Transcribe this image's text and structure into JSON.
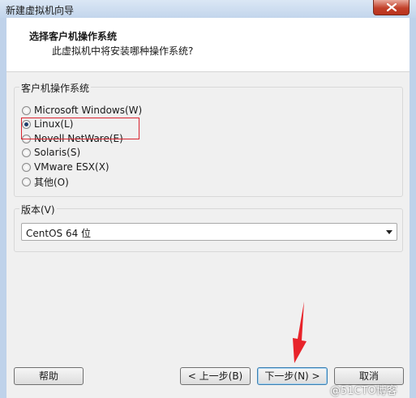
{
  "window": {
    "title": "新建虚拟机向导",
    "close_icon": "close-icon"
  },
  "header": {
    "title": "选择客户机操作系统",
    "subtitle": "此虚拟机中将安装哪种操作系统?"
  },
  "os_group": {
    "label": "客户机操作系统",
    "options": [
      {
        "label": "Microsoft Windows(W)",
        "checked": false
      },
      {
        "label": "Linux(L)",
        "checked": true
      },
      {
        "label": "Novell NetWare(E)",
        "checked": false
      },
      {
        "label": "Solaris(S)",
        "checked": false
      },
      {
        "label": "VMware ESX(X)",
        "checked": false
      },
      {
        "label": "其他(O)",
        "checked": false
      }
    ]
  },
  "version_group": {
    "label": "版本(V)",
    "selected": "CentOS 64 位"
  },
  "buttons": {
    "help": "帮助",
    "back": "< 上一步(B)",
    "next": "下一步(N) >",
    "cancel": "取消"
  },
  "annotation": {
    "highlight_color": "#d9242f",
    "arrow_color": "#e8232a"
  },
  "watermark": "@51CTO博客"
}
